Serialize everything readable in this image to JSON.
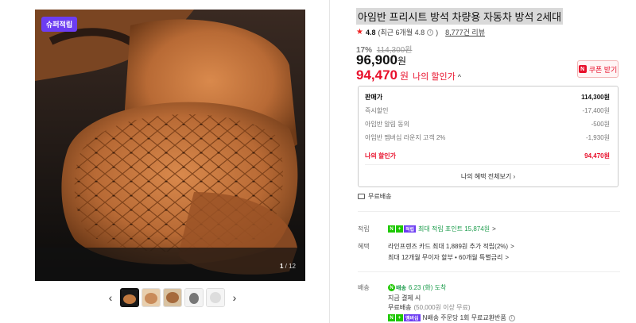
{
  "gallery": {
    "badge": "슈퍼적립",
    "counter_current": "1",
    "counter_total": "/ 12",
    "thumbnail_count": 5,
    "active_thumbnail": 1
  },
  "product": {
    "title": "아임반 프리시트 방석 차량용 자동차 방석 2세대",
    "rating": "4.8",
    "rating_detail": "(최근 6개월 4.8",
    "rating_info_close": ")",
    "reviews": "8,777건 리뷰",
    "discount_pct": "17%",
    "original_price": "114,300원",
    "price": "96,900",
    "price_unit": "원",
    "my_price": "94,470",
    "my_price_unit": "원",
    "my_price_label": "나의 할인가",
    "coupon_label": "쿠폰 받기",
    "coupon_icon": "N"
  },
  "price_box": {
    "rows": [
      {
        "label": "판매가",
        "value": "114,300원"
      },
      {
        "label": "즉시할인",
        "value": "-17,400원"
      },
      {
        "label": "아임반 알림 동의",
        "value": "-500원"
      },
      {
        "label": "아임반 멤버십 라운지 고객 2%",
        "value": "-1,930원"
      }
    ],
    "my_label": "나의 할인가",
    "my_value": "94,470원",
    "benefit_link": "나의 혜택 전체보기"
  },
  "shipping_free": "무료배송",
  "points": {
    "label": "적립",
    "badge_text": "적립",
    "text": "최대 적립 포인트 15,874원",
    "chevron": ">"
  },
  "benefits": {
    "label": "혜택",
    "line1": "라인프렌즈 카드 최대 1,889원 추가 적립(2%)",
    "line2": "최대 12개월 무이자 할부 • 60개월 특별금리",
    "chevron": ">"
  },
  "delivery": {
    "label": "배송",
    "badge": "N",
    "badge_text": "배송",
    "date": "6.23 (화) 도착",
    "line1": "지금 결제 시",
    "line2": "무료배송",
    "line2_note": "(50,000원 이상 무료)",
    "line3": "N배송 주문당 1회 무료교환반품",
    "line3_badge": "멤버십"
  },
  "colors": {
    "accent_red": "#e8102b",
    "naver_green": "#1ec800",
    "purple": "#6c3df2"
  }
}
